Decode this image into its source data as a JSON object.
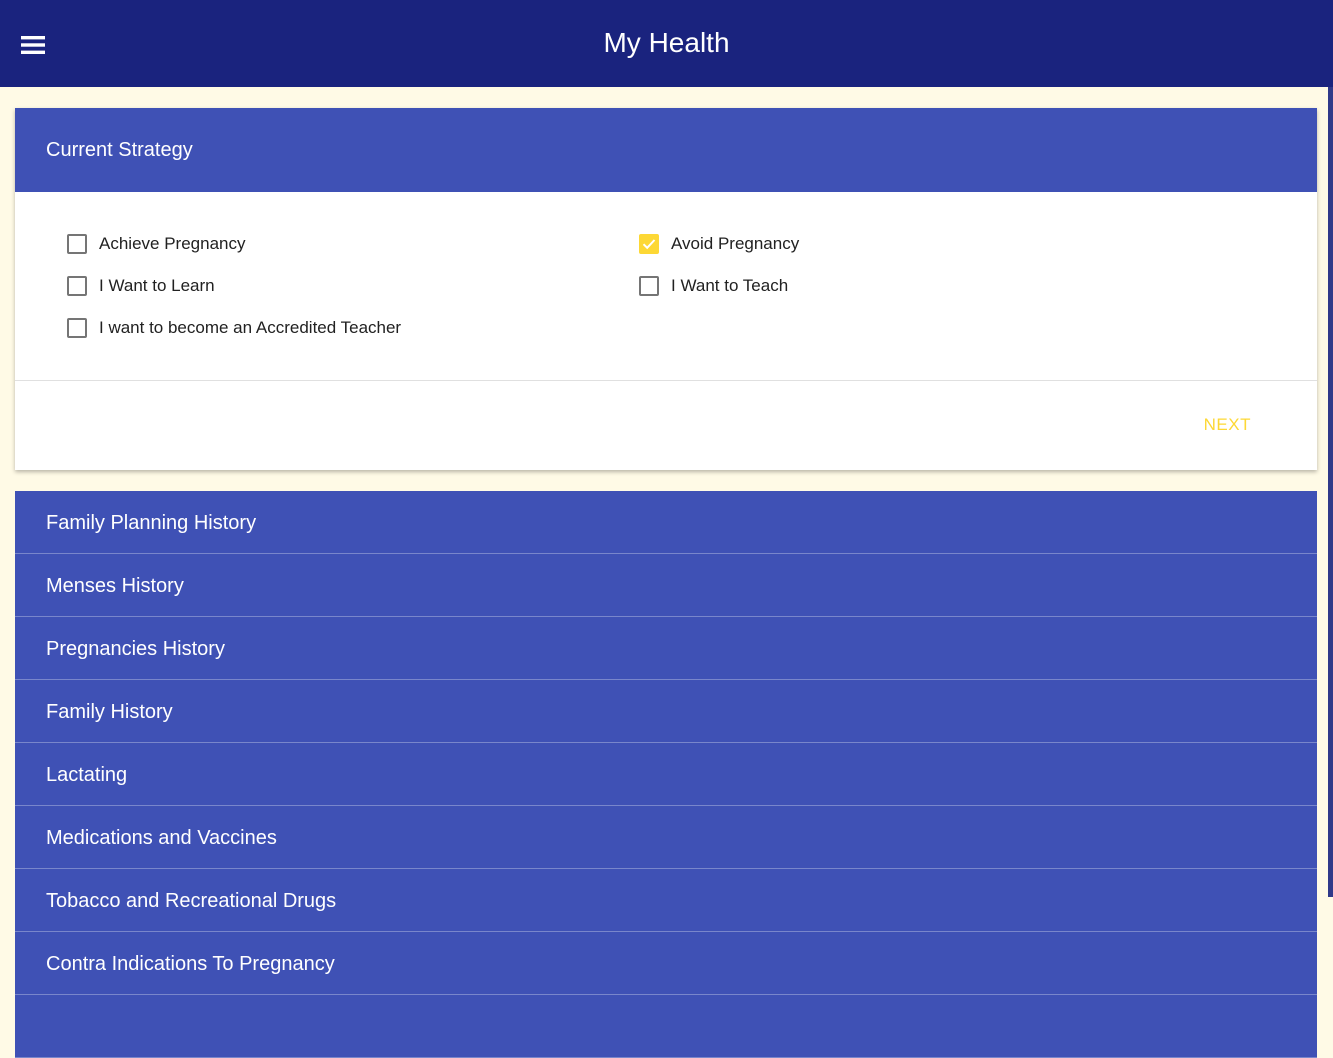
{
  "app_bar": {
    "title": "My Health",
    "menu_icon": "hamburger-menu-icon"
  },
  "strategy_card": {
    "title": "Current Strategy",
    "options": [
      {
        "label": "Achieve Pregnancy",
        "checked": false
      },
      {
        "label": "Avoid Pregnancy",
        "checked": true
      },
      {
        "label": "I Want to Learn",
        "checked": false
      },
      {
        "label": "I Want to Teach",
        "checked": false
      },
      {
        "label": "I want to become an Accredited Teacher",
        "checked": false
      }
    ],
    "next_label": "NEXT"
  },
  "sections": [
    {
      "label": "Family Planning History"
    },
    {
      "label": "Menses History"
    },
    {
      "label": "Pregnancies History"
    },
    {
      "label": "Family History"
    },
    {
      "label": "Lactating"
    },
    {
      "label": "Medications and Vaccines"
    },
    {
      "label": "Tobacco and Recreational Drugs"
    },
    {
      "label": "Contra Indications To Pregnancy"
    },
    {
      "label": ""
    }
  ],
  "colors": {
    "app_bar": "#1a237e",
    "panel": "#3f51b5",
    "accent": "#fdd835",
    "background": "#fffae6"
  }
}
